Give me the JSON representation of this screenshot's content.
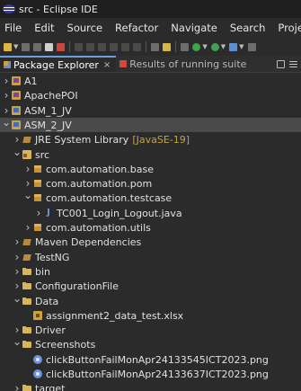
{
  "window": {
    "title": "src - Eclipse IDE",
    "logo_icon": "eclipse-logo-icon"
  },
  "menu": [
    "File",
    "Edit",
    "Source",
    "Refactor",
    "Navigate",
    "Search",
    "Project"
  ],
  "view_tabs": [
    {
      "label": "Package Explorer",
      "close": "×",
      "icon": "package-explorer-icon"
    },
    {
      "label": "Results of running suite",
      "icon": "junit-results-icon"
    }
  ],
  "tree": [
    {
      "label": "A1",
      "depth": 0,
      "state": "collapsed",
      "icon": "project"
    },
    {
      "label": "ApachePOI",
      "depth": 0,
      "state": "collapsed",
      "icon": "project"
    },
    {
      "label": "ASM_1_JV",
      "depth": 0,
      "state": "collapsed",
      "icon": "project-j"
    },
    {
      "label": "ASM_2_JV",
      "depth": 0,
      "state": "expanded",
      "icon": "project-j",
      "selected": true
    },
    {
      "label": "JRE System Library",
      "decoration": "[JavaSE-19]",
      "depth": 1,
      "state": "collapsed",
      "icon": "library"
    },
    {
      "label": "src",
      "depth": 1,
      "state": "expanded",
      "icon": "srcfolder"
    },
    {
      "label": "com.automation.base",
      "depth": 2,
      "state": "collapsed",
      "icon": "package"
    },
    {
      "label": "com.automation.pom",
      "depth": 2,
      "state": "collapsed",
      "icon": "package"
    },
    {
      "label": "com.automation.testcase",
      "depth": 2,
      "state": "expanded",
      "icon": "package"
    },
    {
      "label": "TC001_Login_Logout.java",
      "depth": 3,
      "state": "collapsed",
      "icon": "java"
    },
    {
      "label": "com.automation.utils",
      "depth": 2,
      "state": "collapsed",
      "icon": "package"
    },
    {
      "label": "Maven Dependencies",
      "depth": 1,
      "state": "collapsed",
      "icon": "library"
    },
    {
      "label": "TestNG",
      "depth": 1,
      "state": "collapsed",
      "icon": "library"
    },
    {
      "label": "bin",
      "depth": 1,
      "state": "collapsed",
      "icon": "folder"
    },
    {
      "label": "ConfigurationFile",
      "depth": 1,
      "state": "collapsed",
      "icon": "folder"
    },
    {
      "label": "Data",
      "depth": 1,
      "state": "expanded",
      "icon": "folder"
    },
    {
      "label": "assignment2_data_test.xlsx",
      "depth": 2,
      "state": "none",
      "icon": "xlsx"
    },
    {
      "label": "Driver",
      "depth": 1,
      "state": "collapsed",
      "icon": "folder"
    },
    {
      "label": "Screenshots",
      "depth": 1,
      "state": "expanded",
      "icon": "folder"
    },
    {
      "label": "clickButtonFailMonApr24133545ICT2023.png",
      "depth": 2,
      "state": "none",
      "icon": "png"
    },
    {
      "label": "clickButtonFailMonApr24133637ICT2023.png",
      "depth": 2,
      "state": "none",
      "icon": "png"
    },
    {
      "label": "target",
      "depth": 1,
      "state": "collapsed",
      "icon": "folder"
    }
  ]
}
